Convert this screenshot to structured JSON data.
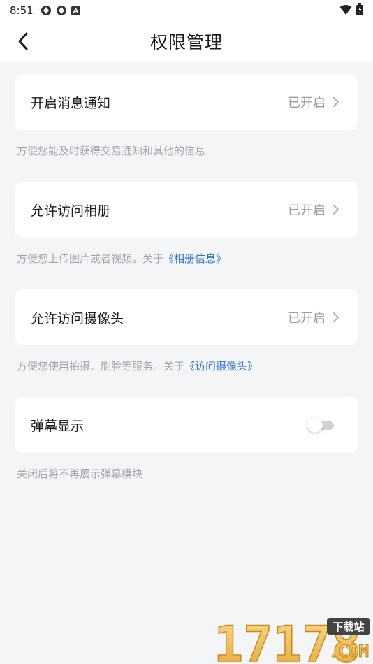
{
  "status_bar": {
    "time": "8:51"
  },
  "header": {
    "title": "权限管理"
  },
  "settings": [
    {
      "label": "开启消息通知",
      "status": "已开启",
      "description": "方便您能及时获得交易通知和其他的信息"
    },
    {
      "label": "允许访问相册",
      "status": "已开启",
      "description_prefix": "方便您上传图片或者视频。关于",
      "description_link": "《相册信息》"
    },
    {
      "label": "允许访问摄像头",
      "status": "已开启",
      "description_prefix": "方便您使用拍摄、刷脸等服务。关于",
      "description_link": "《访问摄像头》"
    },
    {
      "label": "弹幕显示",
      "toggle_on": false,
      "description": "关闭后将不再展示弹幕模块"
    }
  ],
  "watermark": {
    "text": "17178",
    "badge": "下载站",
    "suffix": ".COM"
  },
  "colors": {
    "link": "#2f6fd8",
    "background": "#f4f5f7",
    "muted": "#a3a5aa"
  }
}
